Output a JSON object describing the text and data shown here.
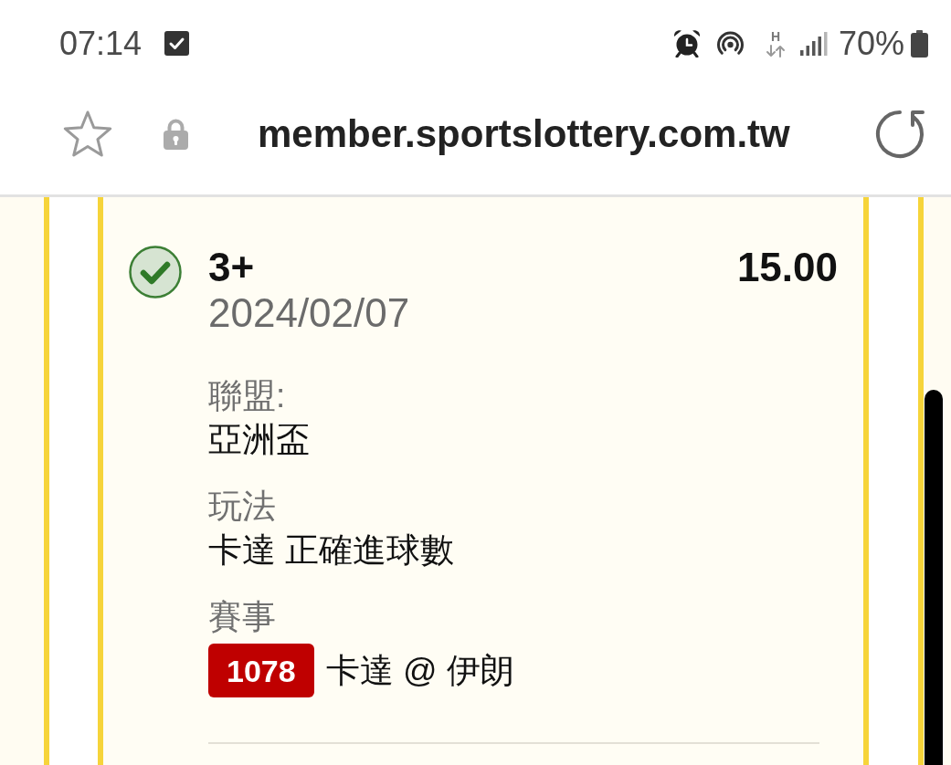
{
  "status_bar": {
    "time": "07:14",
    "network_type": "H",
    "battery": "70%"
  },
  "address_bar": {
    "url": "member.sportslottery.com.tw"
  },
  "bet": {
    "won": true,
    "selection": "3+",
    "odds": "15.00",
    "date": "2024/02/07",
    "fields": [
      {
        "kind": "text",
        "label": "聯盟:",
        "value": "亞洲盃"
      },
      {
        "kind": "text",
        "label": "玩法",
        "value": "卡達 正確進球數"
      },
      {
        "kind": "event",
        "label": "賽事",
        "code": "1078",
        "value": "卡達 @ 伊朗"
      }
    ]
  }
}
